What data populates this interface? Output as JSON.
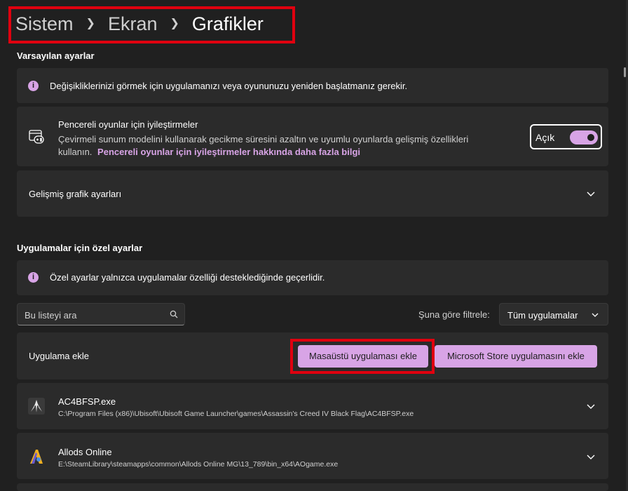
{
  "breadcrumb": {
    "items": [
      "Sistem",
      "Ekran"
    ],
    "current": "Grafikler"
  },
  "default_settings": {
    "title": "Varsayılan ayarlar",
    "restart_notice": "Değişikliklerinizi görmek için uygulamanızı veya oyununuzu yeniden başlatmanız gerekir.",
    "windowed_opt": {
      "title": "Pencereli oyunlar için iyileştirmeler",
      "description_line1": "Çevirmeli sunum modelini kullanarak gecikme süresini azaltın ve uyumlu oyunlarda gelişmiş özellikleri",
      "description_line2": "kullanın.",
      "link": "Pencereli oyunlar için iyileştirmeler hakkında daha fazla bilgi",
      "toggle_label": "Açık",
      "toggle_state": "on"
    },
    "advanced": {
      "label": "Gelişmiş grafik ayarları"
    }
  },
  "app_settings": {
    "title": "Uygulamalar için özel ayarlar",
    "notice": "Özel ayarlar yalnızca uygulamalar özelliği desteklediğinde geçerlidir.",
    "search_placeholder": "Bu listeyi ara",
    "filter_label": "Şuna göre filtrele:",
    "filter_value": "Tüm uygulamalar",
    "add_app": {
      "label": "Uygulama ekle",
      "desktop_button": "Masaüstü uygulaması ekle",
      "store_button": "Microsoft Store uygulamasını ekle"
    },
    "apps": [
      {
        "name": "AC4BFSP.exe",
        "path": "C:\\Program Files (x86)\\Ubisoft\\Ubisoft Game Launcher\\games\\Assassin's Creed IV Black Flag\\AC4BFSP.exe",
        "icon": "assassins-creed-icon"
      },
      {
        "name": "Allods Online",
        "path": "E:\\SteamLibrary\\steamapps\\common\\Allods Online MG\\13_789\\bin_x64\\AOgame.exe",
        "icon": "allods-online-icon"
      }
    ]
  },
  "colors": {
    "accent": "#d8a4e6",
    "background": "#202020",
    "card": "#2b2b2b",
    "highlight_box": "#e0000f"
  }
}
